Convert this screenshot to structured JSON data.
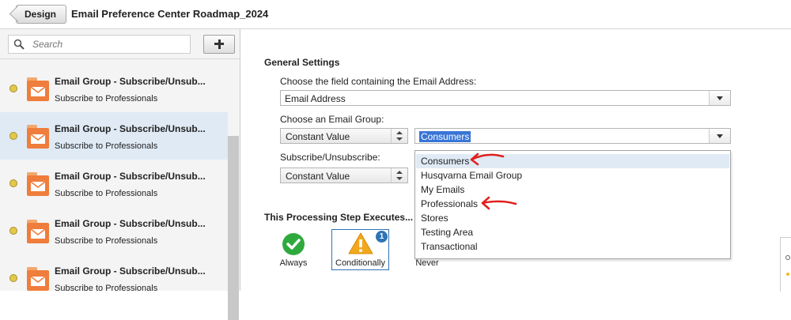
{
  "header": {
    "back_button_label": "Design",
    "title": "Email Preference Center Roadmap_2024"
  },
  "sidebar": {
    "search_placeholder": "Search",
    "add_button_icon": "plus-icon",
    "items": [
      {
        "title": "Email Group - Subscribe/Unsub...",
        "subtitle": "Subscribe to Professionals",
        "status_color": "#e3c84c",
        "selected": false
      },
      {
        "title": "Email Group - Subscribe/Unsub...",
        "subtitle": "Subscribe to Professionals",
        "status_color": "#e3c84c",
        "selected": true
      },
      {
        "title": "Email Group - Subscribe/Unsub...",
        "subtitle": "Subscribe to Professionals",
        "status_color": "#e3c84c",
        "selected": false
      },
      {
        "title": "Email Group - Subscribe/Unsub...",
        "subtitle": "Subscribe to Professionals",
        "status_color": "#e3c84c",
        "selected": false
      },
      {
        "title": "Email Group - Subscribe/Unsub...",
        "subtitle": "Subscribe to Professionals",
        "status_color": "#e3c84c",
        "selected": false
      }
    ]
  },
  "general_settings": {
    "title": "General Settings",
    "email_field_label": "Choose the field containing the Email Address:",
    "email_field_value": "Email Address",
    "email_group_label": "Choose an Email Group:",
    "email_group_source": "Constant Value",
    "email_group_value": "Consumers",
    "subscribe_label": "Subscribe/Unsubscribe:",
    "subscribe_source": "Constant Value"
  },
  "email_group_dropdown": {
    "options": [
      "Consumers",
      "Husqvarna Email Group",
      "My Emails",
      "Professionals",
      "Stores",
      "Testing Area",
      "Transactional"
    ],
    "hovered": "Consumers"
  },
  "execution": {
    "title": "This Processing Step Executes...",
    "options": [
      {
        "label": "Always",
        "icon": "checkmark-icon"
      },
      {
        "label": "Conditionally",
        "icon": "warning-icon",
        "badge": "1",
        "selected": true
      },
      {
        "label": "Never",
        "icon": "none"
      }
    ]
  },
  "colors": {
    "accent_blue": "#2f73b5",
    "selection_highlight": "#3875d7",
    "annotation_red": "#e0201c",
    "envelope_orange": "#ef7d3c",
    "check_green": "#2eaa3c",
    "warning_orange": "#f2a81d"
  }
}
